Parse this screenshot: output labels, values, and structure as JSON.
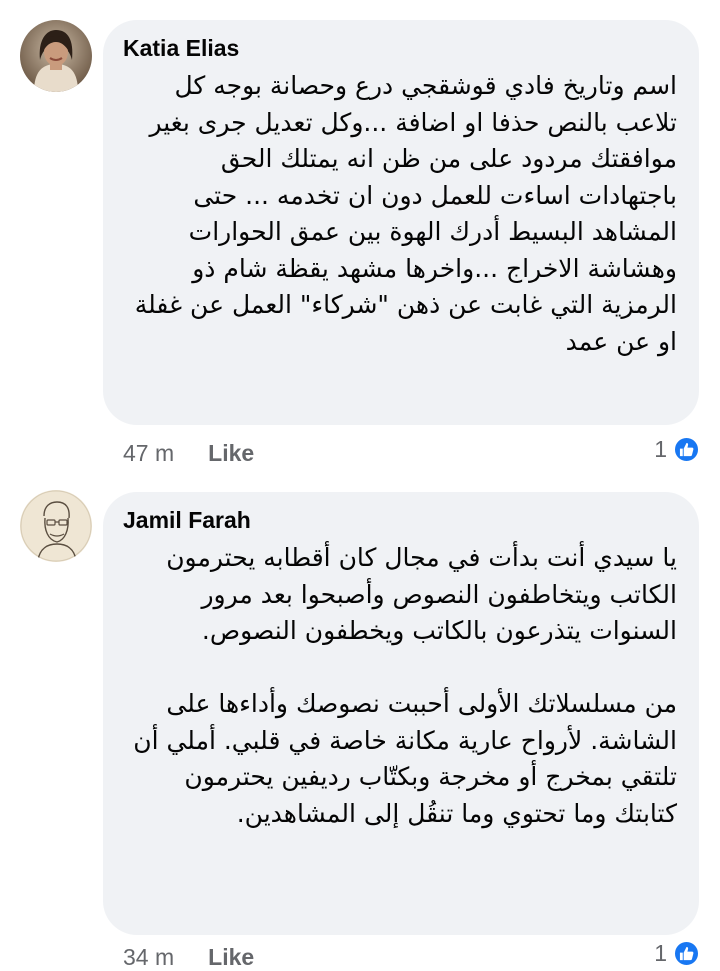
{
  "comments": [
    {
      "author": "Katia Elias",
      "avatar_icon": "profile-photo-woman",
      "paragraphs": [
        "اسم وتاريخ فادي قوشقجي درع وحصانة بوجه كل تلاعب بالنص حذفا او اضافة ...وكل تعديل جرى بغير موافقتك مردود على من ظن انه يمتلك الحق باجتهادات اساءت للعمل دون ان تخدمه ... حتى المشاهد البسيط أدرك الهوة بين عمق الحوارات وهشاشة الاخراج ...واخرها مشهد يقظة شام ذو الرمزية التي غابت عن ذهن \"شركاء\" العمل عن غفلة او  عن عمد"
      ],
      "time": "47 m",
      "like_label": "Like",
      "reaction_count": "1",
      "reaction_icon": "thumbs-up-icon"
    },
    {
      "author": "Jamil Farah",
      "avatar_icon": "profile-sketch-man",
      "paragraphs": [
        "يا سيدي أنت بدأت في مجال كان أقطابه يحترمون الكاتب ويتخاطفون النصوص وأصبحوا بعد مرور السنوات يتذرعون بالكاتب ويخطفون النصوص.",
        "من مسلسلاتك الأولى أحببت نصوصك وأداءها على الشاشة. لأرواح عارية مكانة خاصة في قلبي. أملي أن تلتقي بمخرج أو  مخرجة وبكتّاب رديفين يحترمون كتابتك وما تحتوي وما تنقُل إلى المشاهدين."
      ],
      "time": "34 m",
      "like_label": "Like",
      "reaction_count": "1",
      "reaction_icon": "thumbs-up-icon"
    }
  ],
  "colors": {
    "bubble_bg": "#f0f2f5",
    "meta_text": "#65676b",
    "like_blue": "#1877f2"
  }
}
